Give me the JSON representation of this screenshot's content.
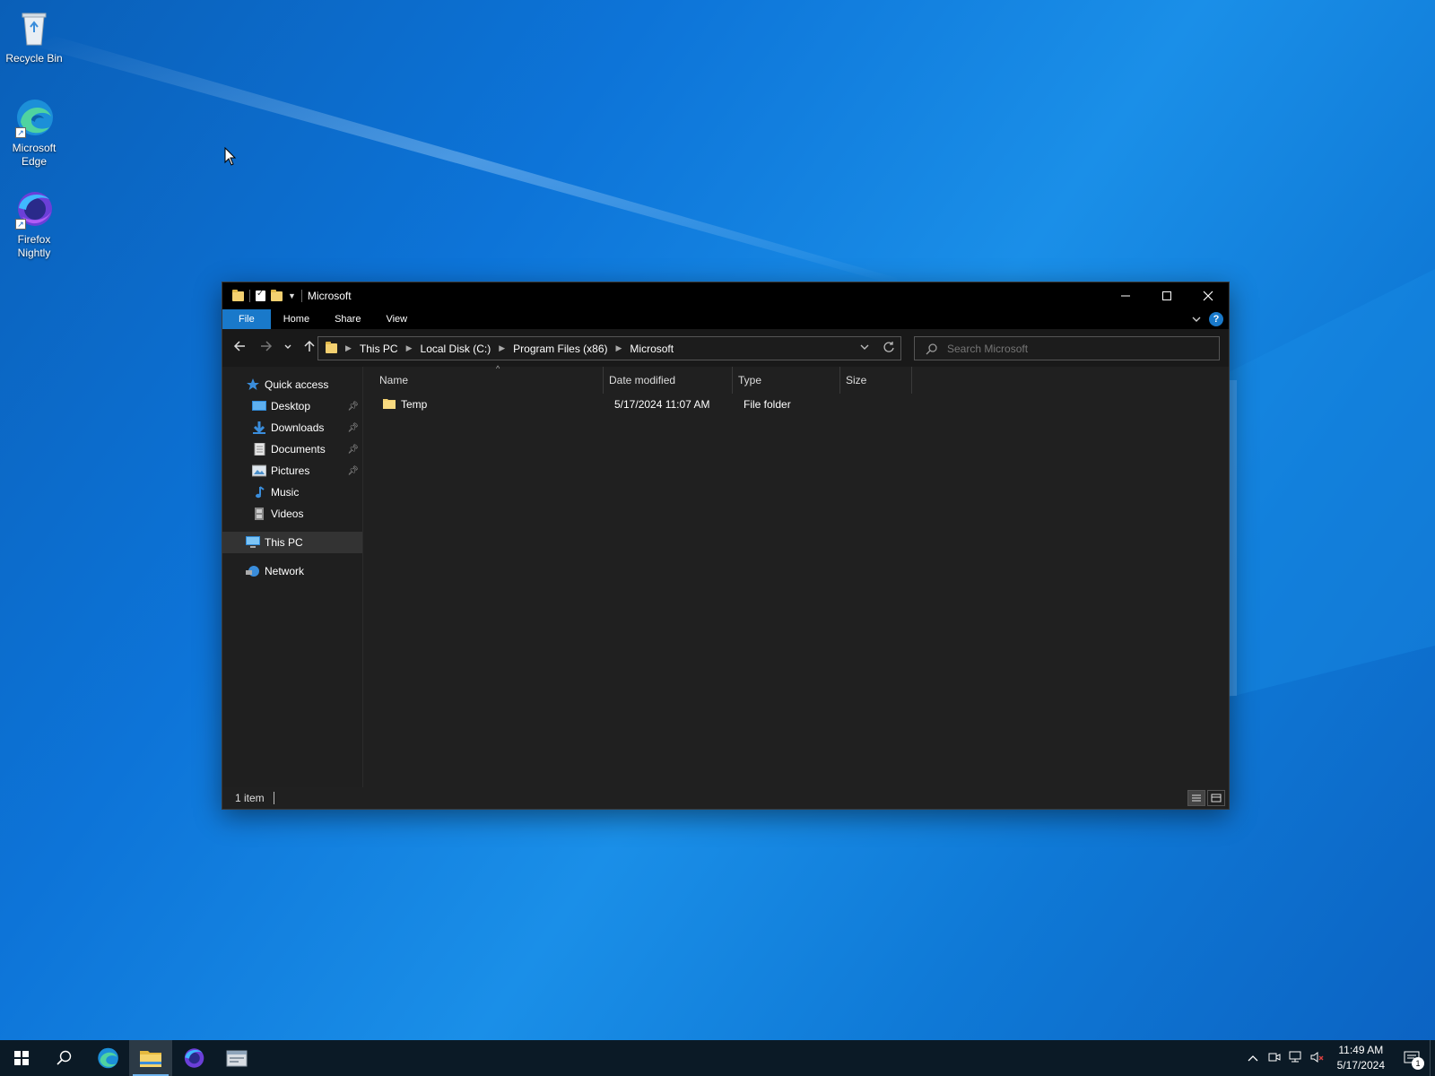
{
  "desktop": {
    "icons": [
      {
        "label": "Recycle Bin"
      },
      {
        "label": "Microsoft Edge"
      },
      {
        "label": "Firefox Nightly"
      }
    ]
  },
  "window": {
    "title": "Microsoft",
    "ribbon_tabs": [
      "File",
      "Home",
      "Share",
      "View"
    ],
    "help_label": "?",
    "breadcrumbs": [
      "This PC",
      "Local Disk (C:)",
      "Program Files (x86)",
      "Microsoft"
    ],
    "search_placeholder": "Search Microsoft",
    "nav_pane": {
      "quick_access": "Quick access",
      "pinned": [
        {
          "label": "Desktop",
          "pinned": true
        },
        {
          "label": "Downloads",
          "pinned": true
        },
        {
          "label": "Documents",
          "pinned": true
        },
        {
          "label": "Pictures",
          "pinned": true
        },
        {
          "label": "Music",
          "pinned": false
        },
        {
          "label": "Videos",
          "pinned": false
        }
      ],
      "this_pc": "This PC",
      "network": "Network"
    },
    "columns": [
      "Name",
      "Date modified",
      "Type",
      "Size"
    ],
    "rows": [
      {
        "name": "Temp",
        "date_modified": "5/17/2024 11:07 AM",
        "type": "File folder",
        "size": ""
      }
    ],
    "status": "1 item"
  },
  "taskbar": {
    "clock_time": "11:49 AM",
    "clock_date": "5/17/2024",
    "notification_count": "1",
    "active_app": "file-explorer"
  },
  "colors": {
    "accent": "#1979ca",
    "folder": "#f3d070",
    "window_bg": "#202020",
    "taskbar_bg": "#0b1a26"
  }
}
